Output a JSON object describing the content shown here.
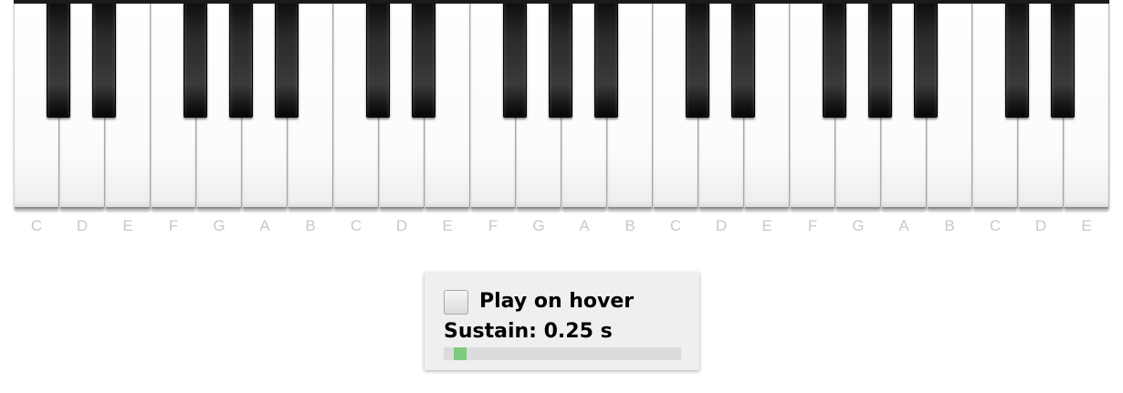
{
  "keyboard": {
    "white_keys": [
      "C",
      "D",
      "E",
      "F",
      "G",
      "A",
      "B",
      "C",
      "D",
      "E",
      "F",
      "G",
      "A",
      "B",
      "C",
      "D",
      "E",
      "F",
      "G",
      "A",
      "B",
      "C",
      "D",
      "E"
    ],
    "black_keys": [
      "C#",
      "D#",
      "F#",
      "G#",
      "A#",
      "C#",
      "D#",
      "F#",
      "G#",
      "A#",
      "C#",
      "D#",
      "F#",
      "G#",
      "A#",
      "C#",
      "D#"
    ]
  },
  "controls": {
    "play_on_hover_label": "Play on hover",
    "play_on_hover_checked": false,
    "sustain_label": "Sustain: 0.25 s",
    "sustain_value": 0.25,
    "sustain_min": 0,
    "sustain_max": 10,
    "slider_fill_color": "#7ccb7f",
    "slider_track_color": "#dcdcdc"
  }
}
